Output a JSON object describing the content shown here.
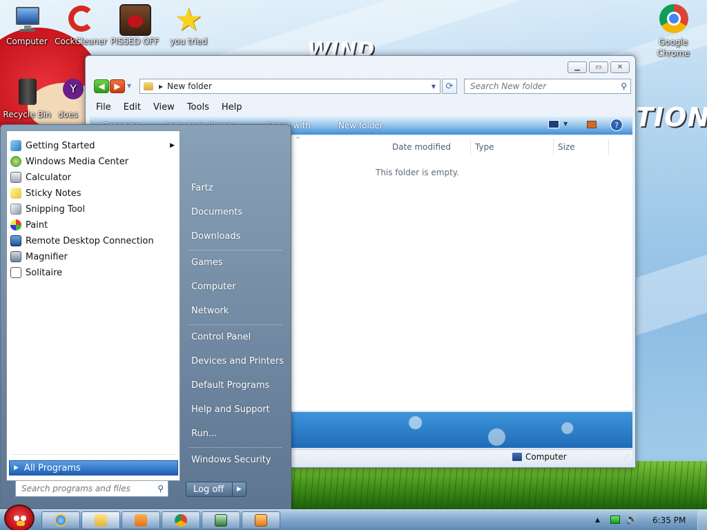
{
  "desktop": {
    "icons": [
      {
        "label": "Computer",
        "icon": "computer-icon"
      },
      {
        "label": "CockCleaner",
        "icon": "ccleaner-icon"
      },
      {
        "label": "PISSED OFF",
        "icon": "angry-birds-seasons-icon"
      },
      {
        "label": "you tried",
        "icon": "star-icon"
      },
      {
        "label": "Google Chrome",
        "icon": "chrome-icon"
      },
      {
        "label": "Recycle Bin",
        "icon": "recycle-bin-icon"
      },
      {
        "label": "does",
        "icon": "yahoo-icon"
      }
    ],
    "wallpaper_text_left": "WIND",
    "wallpaper_text_right": "TION"
  },
  "explorer": {
    "breadcrumb": "New folder",
    "search_placeholder": "Search New folder",
    "menu": [
      "File",
      "Edit",
      "View",
      "Tools",
      "Help"
    ],
    "command_bar": [
      "Organize",
      "Include in library",
      "Share with",
      "New folder"
    ],
    "columns": [
      "Date modified",
      "Type",
      "Size"
    ],
    "empty_message": "This folder is empty.",
    "status_location": "Computer",
    "window_buttons": [
      "minimize",
      "maximize",
      "close"
    ]
  },
  "start_menu": {
    "programs": [
      {
        "label": "Getting Started",
        "icon": "getting-started-icon",
        "submenu": true
      },
      {
        "label": "Windows Media Center",
        "icon": "media-center-icon"
      },
      {
        "label": "Calculator",
        "icon": "calculator-icon"
      },
      {
        "label": "Sticky Notes",
        "icon": "sticky-notes-icon"
      },
      {
        "label": "Snipping Tool",
        "icon": "snipping-tool-icon"
      },
      {
        "label": "Paint",
        "icon": "paint-icon"
      },
      {
        "label": "Remote Desktop Connection",
        "icon": "remote-desktop-icon"
      },
      {
        "label": "Magnifier",
        "icon": "magnifier-icon"
      },
      {
        "label": "Solitaire",
        "icon": "solitaire-icon"
      }
    ],
    "all_programs": "All Programs",
    "search_placeholder": "Search programs and files",
    "right_items": [
      "Fartz",
      "Documents",
      "Downloads",
      "Games",
      "Computer",
      "Network",
      "Control Panel",
      "Devices and Printers",
      "Default Programs",
      "Help and Support",
      "Run...",
      "Windows Security"
    ],
    "log_off": "Log off"
  },
  "taskbar": {
    "pinned": [
      "internet-explorer-icon",
      "windows-explorer-icon",
      "media-player-icon",
      "chrome-icon",
      "task-manager-icon",
      "flash-icon"
    ],
    "clock": "6:35 PM"
  },
  "colors": {
    "accent": "#1c5fb5",
    "start_menu_right": "#5d7590",
    "taskbar": "#7fa6cc"
  }
}
